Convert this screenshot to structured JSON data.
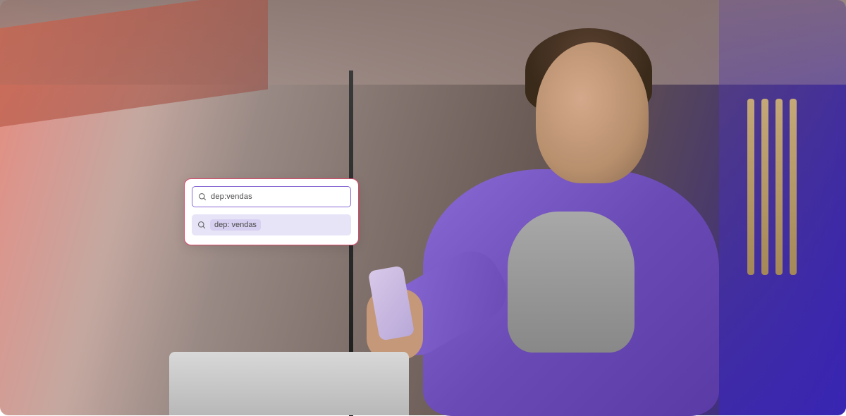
{
  "search": {
    "input_value": "dep:vendas",
    "suggestion": "dep: vendas"
  }
}
